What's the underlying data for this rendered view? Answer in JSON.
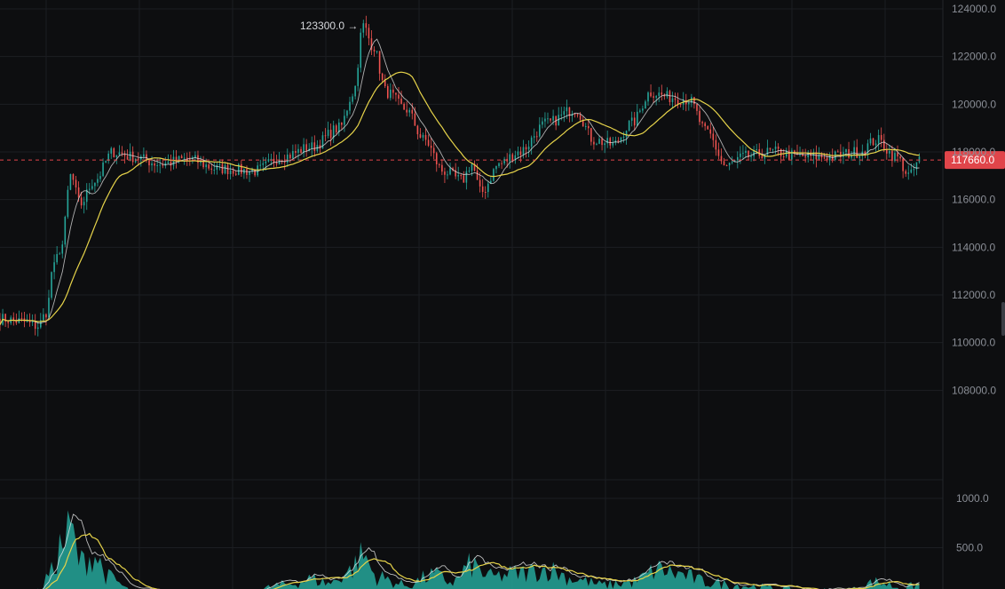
{
  "chart_data": [
    {
      "type": "candlestick",
      "title": "",
      "ylim": [
        106000,
        124000
      ],
      "y_ticks": [
        {
          "value": 124000,
          "label": "124000.0"
        },
        {
          "value": 122000,
          "label": "122000.0"
        },
        {
          "value": 120000,
          "label": "120000.0"
        },
        {
          "value": 118000,
          "label": "118000.0"
        },
        {
          "value": 116000,
          "label": "116000.0"
        },
        {
          "value": 114000,
          "label": "114000.0"
        },
        {
          "value": 112000,
          "label": "112000.0"
        },
        {
          "value": 110000,
          "label": "110000.0"
        },
        {
          "value": 108000,
          "label": "108000.0"
        }
      ],
      "grid": true,
      "colors": {
        "up": "#26a69a",
        "down": "#ef5350",
        "ma_fast": "#e8e8e8",
        "ma_slow": "#e6d34a",
        "last_price": "#e0454a"
      },
      "last_price": {
        "value": 117660,
        "label": "117660.0"
      },
      "high_annotation": {
        "value": 123300,
        "label": "123300.0 →"
      },
      "series_keypoints": [
        [
          0,
          111000
        ],
        [
          0.02,
          110900
        ],
        [
          0.04,
          110700
        ],
        [
          0.05,
          111300
        ],
        [
          0.055,
          113000
        ],
        [
          0.065,
          114000
        ],
        [
          0.075,
          117000
        ],
        [
          0.085,
          115800
        ],
        [
          0.1,
          116800
        ],
        [
          0.12,
          118000
        ],
        [
          0.14,
          117800
        ],
        [
          0.17,
          117500
        ],
        [
          0.2,
          117700
        ],
        [
          0.23,
          117300
        ],
        [
          0.27,
          117200
        ],
        [
          0.3,
          117800
        ],
        [
          0.33,
          118200
        ],
        [
          0.36,
          119000
        ],
        [
          0.375,
          120500
        ],
        [
          0.385,
          123300
        ],
        [
          0.395,
          122500
        ],
        [
          0.41,
          120500
        ],
        [
          0.43,
          119800
        ],
        [
          0.45,
          118500
        ],
        [
          0.47,
          117200
        ],
        [
          0.49,
          116800
        ],
        [
          0.5,
          117500
        ],
        [
          0.51,
          116300
        ],
        [
          0.53,
          117500
        ],
        [
          0.55,
          118000
        ],
        [
          0.58,
          119200
        ],
        [
          0.61,
          119800
        ],
        [
          0.63,
          118500
        ],
        [
          0.65,
          118300
        ],
        [
          0.67,
          119200
        ],
        [
          0.69,
          120500
        ],
        [
          0.71,
          120300
        ],
        [
          0.73,
          120200
        ],
        [
          0.75,
          118800
        ],
        [
          0.77,
          117400
        ],
        [
          0.79,
          117800
        ],
        [
          0.82,
          118000
        ],
        [
          0.85,
          117800
        ],
        [
          0.88,
          117800
        ],
        [
          0.91,
          118000
        ],
        [
          0.93,
          118500
        ],
        [
          0.95,
          117800
        ],
        [
          0.965,
          117000
        ],
        [
          0.975,
          117660
        ]
      ]
    },
    {
      "type": "volume",
      "ylim": [
        0,
        1200
      ],
      "y_ticks": [
        {
          "value": 1000,
          "label": "1000.0"
        },
        {
          "value": 500,
          "label": "500.0"
        }
      ],
      "colors": {
        "area": "#26a69a",
        "ma_fast": "#e8e8e8",
        "ma_slow": "#e6d34a"
      },
      "volume_keypoints": [
        [
          0,
          30
        ],
        [
          0.04,
          60
        ],
        [
          0.055,
          250
        ],
        [
          0.065,
          520
        ],
        [
          0.075,
          680
        ],
        [
          0.085,
          350
        ],
        [
          0.1,
          420
        ],
        [
          0.115,
          200
        ],
        [
          0.14,
          60
        ],
        [
          0.2,
          40
        ],
        [
          0.26,
          35
        ],
        [
          0.3,
          120
        ],
        [
          0.33,
          180
        ],
        [
          0.35,
          140
        ],
        [
          0.37,
          260
        ],
        [
          0.385,
          420
        ],
        [
          0.4,
          200
        ],
        [
          0.43,
          120
        ],
        [
          0.46,
          220
        ],
        [
          0.48,
          150
        ],
        [
          0.5,
          320
        ],
        [
          0.52,
          200
        ],
        [
          0.55,
          240
        ],
        [
          0.58,
          280
        ],
        [
          0.61,
          180
        ],
        [
          0.64,
          120
        ],
        [
          0.67,
          150
        ],
        [
          0.7,
          280
        ],
        [
          0.72,
          230
        ],
        [
          0.75,
          150
        ],
        [
          0.78,
          120
        ],
        [
          0.82,
          90
        ],
        [
          0.86,
          60
        ],
        [
          0.9,
          70
        ],
        [
          0.93,
          150
        ],
        [
          0.96,
          90
        ],
        [
          0.975,
          130
        ]
      ]
    }
  ]
}
